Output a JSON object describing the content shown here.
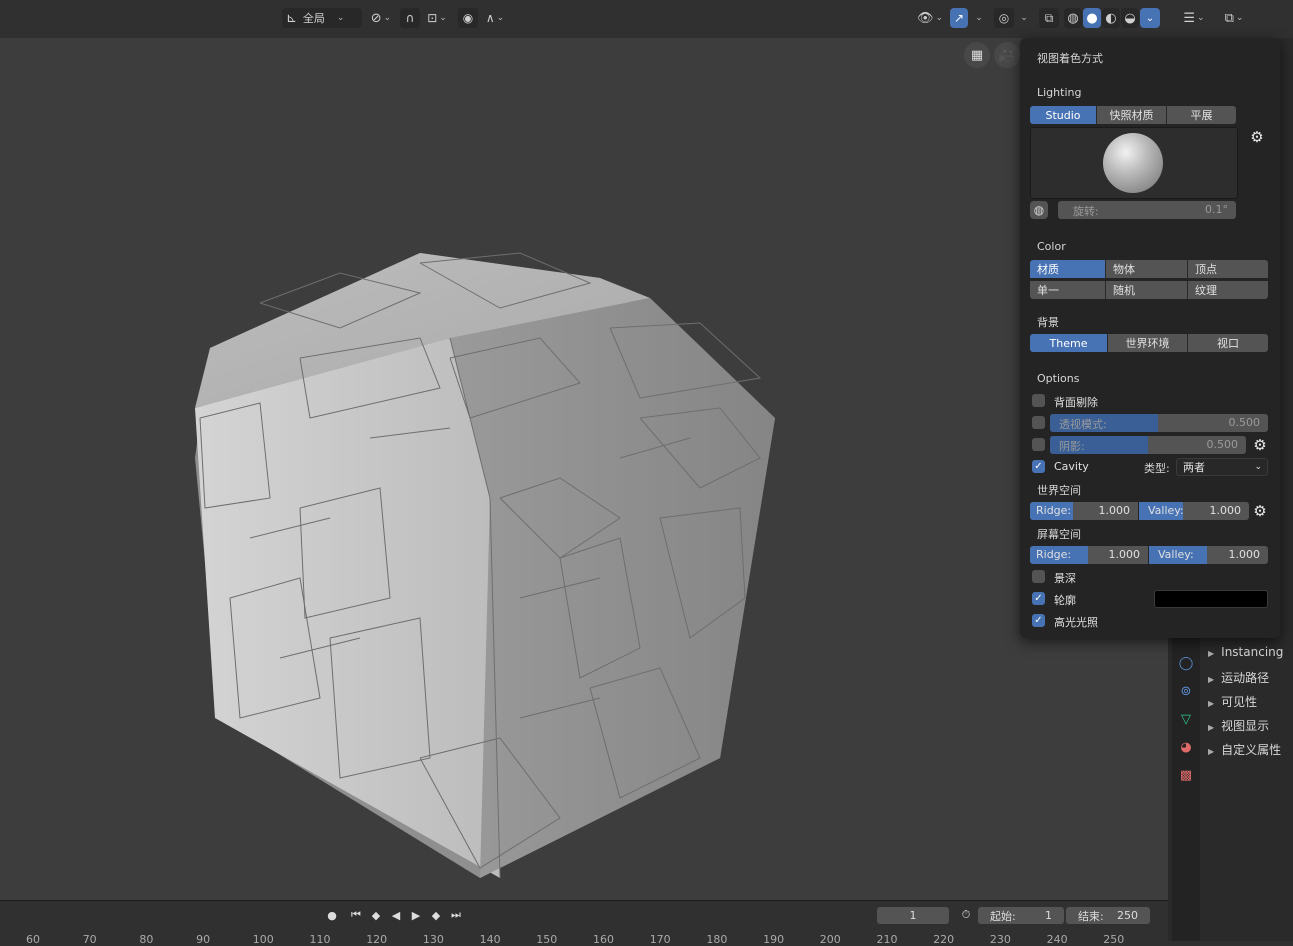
{
  "header": {
    "transform_orientation": "全局",
    "pivot_icon": "pivot-icon",
    "snap_icon": "snap-magnet-icon",
    "proportional_icon": "proportional-edit-icon"
  },
  "viewport": {
    "background_color": "#3d3d3d"
  },
  "popover": {
    "title": "视图着色方式",
    "lighting": {
      "label": "Lighting",
      "options": [
        "Studio",
        "快照材质",
        "平展"
      ],
      "selected": "Studio"
    },
    "rotation": {
      "label": "旋转:",
      "value": "0.1°"
    },
    "color": {
      "label": "Color",
      "options": [
        "材质",
        "物体",
        "顶点",
        "单一",
        "随机",
        "纹理"
      ],
      "selected": "材质"
    },
    "background": {
      "label": "背景",
      "options": [
        "Theme",
        "世界环境",
        "视口"
      ],
      "selected": "Theme"
    },
    "options": {
      "label": "Options",
      "backface": {
        "label": "背面剔除",
        "checked": false
      },
      "xray": {
        "label": "透视模式:",
        "value": "0.500",
        "checked": false,
        "fill": 0.5
      },
      "shadow": {
        "label": "阴影:",
        "value": "0.500",
        "checked": false,
        "fill": 0.45
      },
      "cavity": {
        "label": "Cavity",
        "checked": true,
        "type_label": "类型:",
        "type_value": "两者"
      },
      "world_space": {
        "label": "世界空间",
        "ridge_label": "Ridge:",
        "ridge_value": "1.000",
        "valley_label": "Valley:",
        "valley_value": "1.000"
      },
      "screen_space": {
        "label": "屏幕空间",
        "ridge_label": "Ridge:",
        "ridge_value": "1.000",
        "valley_label": "Valley:",
        "valley_value": "1.000"
      },
      "dof": {
        "label": "景深",
        "checked": false
      },
      "outline": {
        "label": "轮廓",
        "checked": true,
        "color": "#000000"
      },
      "specular": {
        "label": "高光光照",
        "checked": true
      }
    }
  },
  "properties_panel": {
    "items": [
      "Instancing",
      "运动路径",
      "可见性",
      "视图显示",
      "自定义属性"
    ]
  },
  "timeline": {
    "current_frame": "1",
    "start_label": "起始:",
    "start_value": "1",
    "end_label": "结束:",
    "end_value": "250",
    "ruler": [
      "60",
      "70",
      "80",
      "90",
      "100",
      "110",
      "120",
      "130",
      "140",
      "150",
      "160",
      "170",
      "180",
      "190",
      "200",
      "210",
      "220",
      "230",
      "240",
      "250"
    ]
  },
  "colors": {
    "accent": "#4772b3",
    "panel_bg": "#242424",
    "field_bg": "#545454"
  }
}
